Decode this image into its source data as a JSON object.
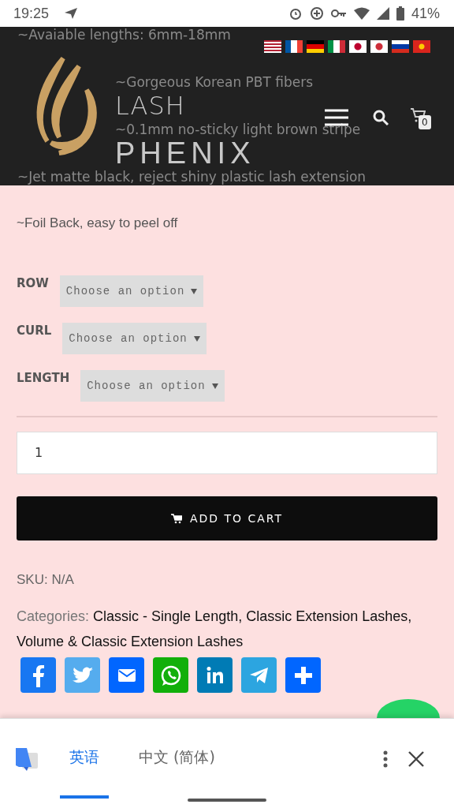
{
  "status_bar": {
    "time": "19:25",
    "battery": "41%"
  },
  "header": {
    "behind_lines": [
      "~Avaiable lengths: 6mm-18mm",
      "~Gorgeous Korean PBT fibers",
      "~0.1mm no-sticky light brown stripe",
      "~Jet matte black, reject shiny plastic lash extension"
    ],
    "logo": {
      "top": "LASH",
      "bottom": "PHENIX"
    },
    "cart_count": "0"
  },
  "description": "~Foil Back, easy to peel off",
  "options": [
    {
      "label": "ROW",
      "placeholder": "Choose an option"
    },
    {
      "label": "CURL",
      "placeholder": "Choose an option"
    },
    {
      "label": "LENGTH",
      "placeholder": "Choose an option"
    }
  ],
  "quantity": "1",
  "add_to_cart": "ADD TO CART",
  "sku": "SKU: N/A",
  "categories": {
    "label": "Categories:",
    "links": [
      "Classic - Single Length,",
      "Classic Extension Lashes,",
      "Volume & Classic Extension Lashes"
    ]
  },
  "share": [
    {
      "kind": "facebook",
      "color": "#1877f2"
    },
    {
      "kind": "twitter",
      "color": "#55acee"
    },
    {
      "kind": "email",
      "color": "#0166ff"
    },
    {
      "kind": "whatsapp",
      "color": "#12af0a"
    },
    {
      "kind": "linkedin",
      "color": "#007bb5"
    },
    {
      "kind": "telegram",
      "color": "#2ca5e0"
    },
    {
      "kind": "share",
      "color": "#0166ff"
    }
  ],
  "translate_bar": {
    "tabs": [
      {
        "label": "英语",
        "selected": true
      },
      {
        "label": "中文 (简体)",
        "selected": false
      }
    ]
  }
}
